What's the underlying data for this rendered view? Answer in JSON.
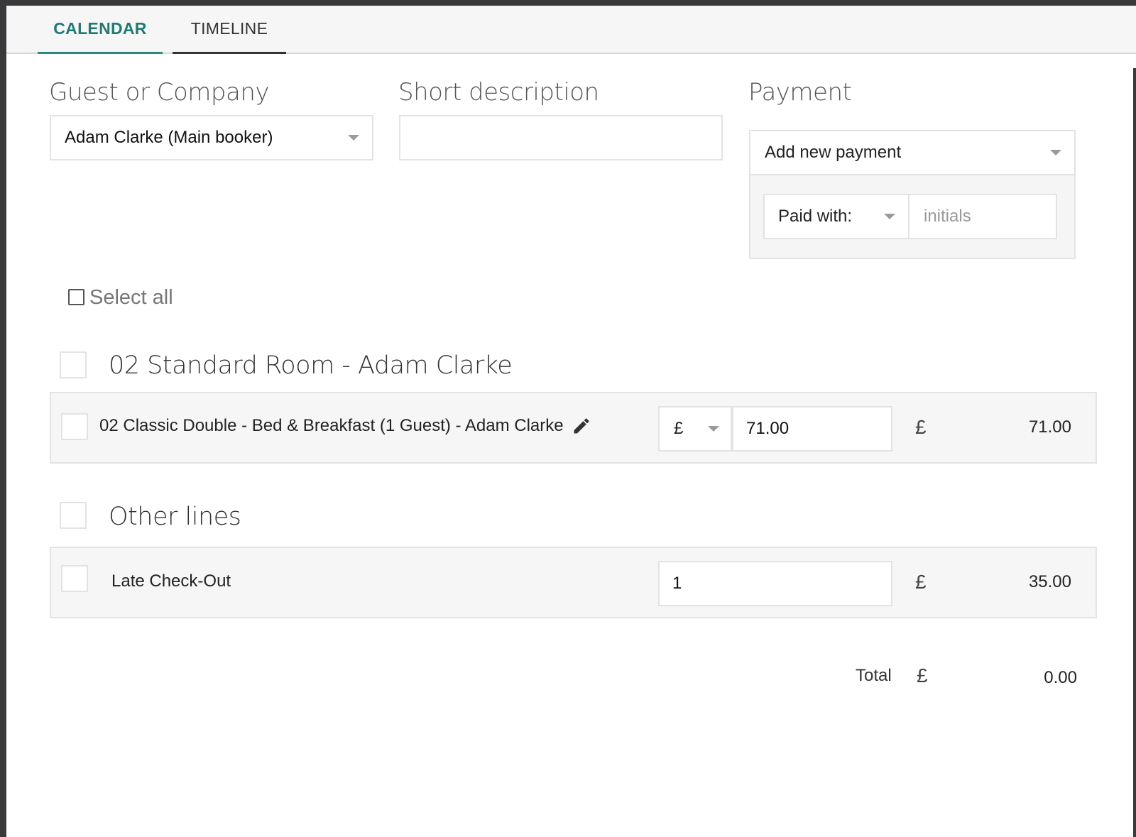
{
  "tabs": [
    {
      "label": "CALENDAR",
      "active": true
    },
    {
      "label": "TIMELINE",
      "active": false
    }
  ],
  "guest": {
    "label": "Guest or Company",
    "selected": "Adam Clarke (Main booker)"
  },
  "description": {
    "label": "Short description",
    "value": ""
  },
  "payment": {
    "label": "Payment",
    "selected": "Add new payment",
    "paid_with": "Paid with:",
    "initials_placeholder": "initials"
  },
  "select_all": {
    "label": "Select all"
  },
  "groups": [
    {
      "title": "02 Standard Room - Adam Clarke",
      "lines": [
        {
          "description": "02 Classic Double - Bed & Breakfast (1 Guest) - Adam Clarke",
          "currency": "£",
          "amount": "71.00",
          "total_currency": "£",
          "total": "71.00"
        }
      ]
    },
    {
      "title": "Other lines",
      "lines": [
        {
          "description": "Late Check-Out",
          "quantity": "1",
          "total_currency": "£",
          "total": "35.00"
        }
      ]
    }
  ],
  "summary": {
    "label": "Total",
    "currency": "£",
    "value": "0.00"
  },
  "colors": {
    "accent": "#1e7b72",
    "row_background": "#f6f6f6",
    "border": "#e3e3e3"
  },
  "icons": {
    "edit": "pencil-icon",
    "dropdown": "caret-down-icon"
  }
}
